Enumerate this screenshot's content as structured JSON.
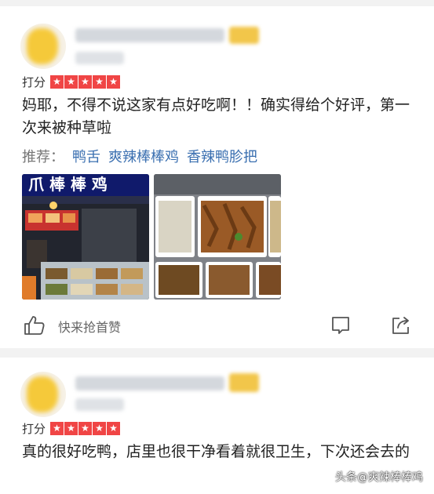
{
  "reviews": [
    {
      "rating_label": "打分",
      "stars": 5,
      "text": "妈耶，不得不说这家有点好吃啊！！确实得给个好评，第一次来被种草啦",
      "recommend_label": "推荐：",
      "recommend_items": [
        "鸭舌",
        "爽辣棒棒鸡",
        "香辣鸭胗把"
      ],
      "photo_sign_text": "爪 棒 棒 鸡",
      "like_text": "快来抢首赞"
    },
    {
      "rating_label": "打分",
      "stars": 5,
      "text": "真的很好吃鸭，店里也很干净看着就很卫生，下次还会去的"
    }
  ],
  "icons": {
    "star": "star-icon",
    "like": "thumbs-up-icon",
    "comment": "comment-icon",
    "share": "share-icon"
  },
  "colors": {
    "star_bg": "#f04545",
    "link": "#3a6fb0",
    "avatar_blur": "#f5c93a"
  },
  "watermark": "头条@爽辣棒棒鸡"
}
